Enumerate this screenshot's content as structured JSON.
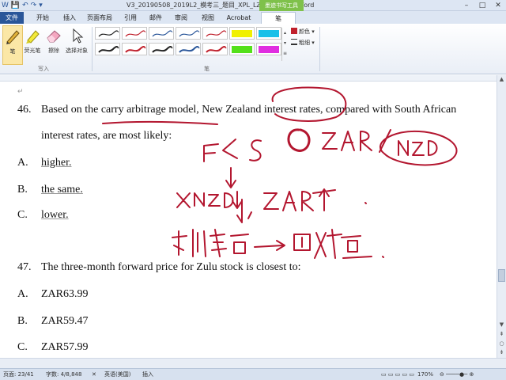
{
  "window": {
    "title": "V3_20190508_2019L2_模考三_题目_XPL_LZ - Microsoft Word",
    "context_tool": "墨迹书写工具"
  },
  "tabs": [
    {
      "label": "文件"
    },
    {
      "label": "开始"
    },
    {
      "label": "插入"
    },
    {
      "label": "页面布局"
    },
    {
      "label": "引用"
    },
    {
      "label": "邮件"
    },
    {
      "label": "审阅"
    },
    {
      "label": "视图"
    },
    {
      "label": "Acrobat"
    },
    {
      "label": "笔"
    }
  ],
  "ribbon": {
    "write_group_label": "写入",
    "pens_group_label": "笔",
    "buttons": {
      "pen": "笔",
      "highlighter": "荧光笔",
      "eraser": "擦除",
      "select_objects": "选择对象"
    },
    "side_options": {
      "color": "颜色",
      "thickness": "粗细"
    },
    "swatch_colors": [
      "#ff2ab9",
      "#19c0e8",
      "#f0f000",
      "#2a98ff",
      "#b84dff"
    ]
  },
  "document": {
    "q46": {
      "number": "46.",
      "line1": "Based on the carry arbitrage model, New Zealand interest rates, compared with South African",
      "line2": "interest rates, are most likely:",
      "options": [
        {
          "letter": "A.",
          "text": "higher."
        },
        {
          "letter": "B.",
          "text": "the same."
        },
        {
          "letter": "C.",
          "text": "lower."
        }
      ]
    },
    "q47": {
      "number": "47.",
      "text": "The three-month forward price for Zulu stock is closest to:",
      "options": [
        {
          "letter": "A.",
          "text": "ZAR63.99"
        },
        {
          "letter": "B.",
          "text": "ZAR59.47"
        },
        {
          "letter": "C.",
          "text": "ZAR57.99"
        }
      ]
    },
    "ink_color": "#b3162f"
  },
  "status": {
    "page": "页面: 23/41",
    "words": "字数: 4/8,848",
    "language": "英语(美国)",
    "mode": "插入",
    "zoom": "170%"
  }
}
